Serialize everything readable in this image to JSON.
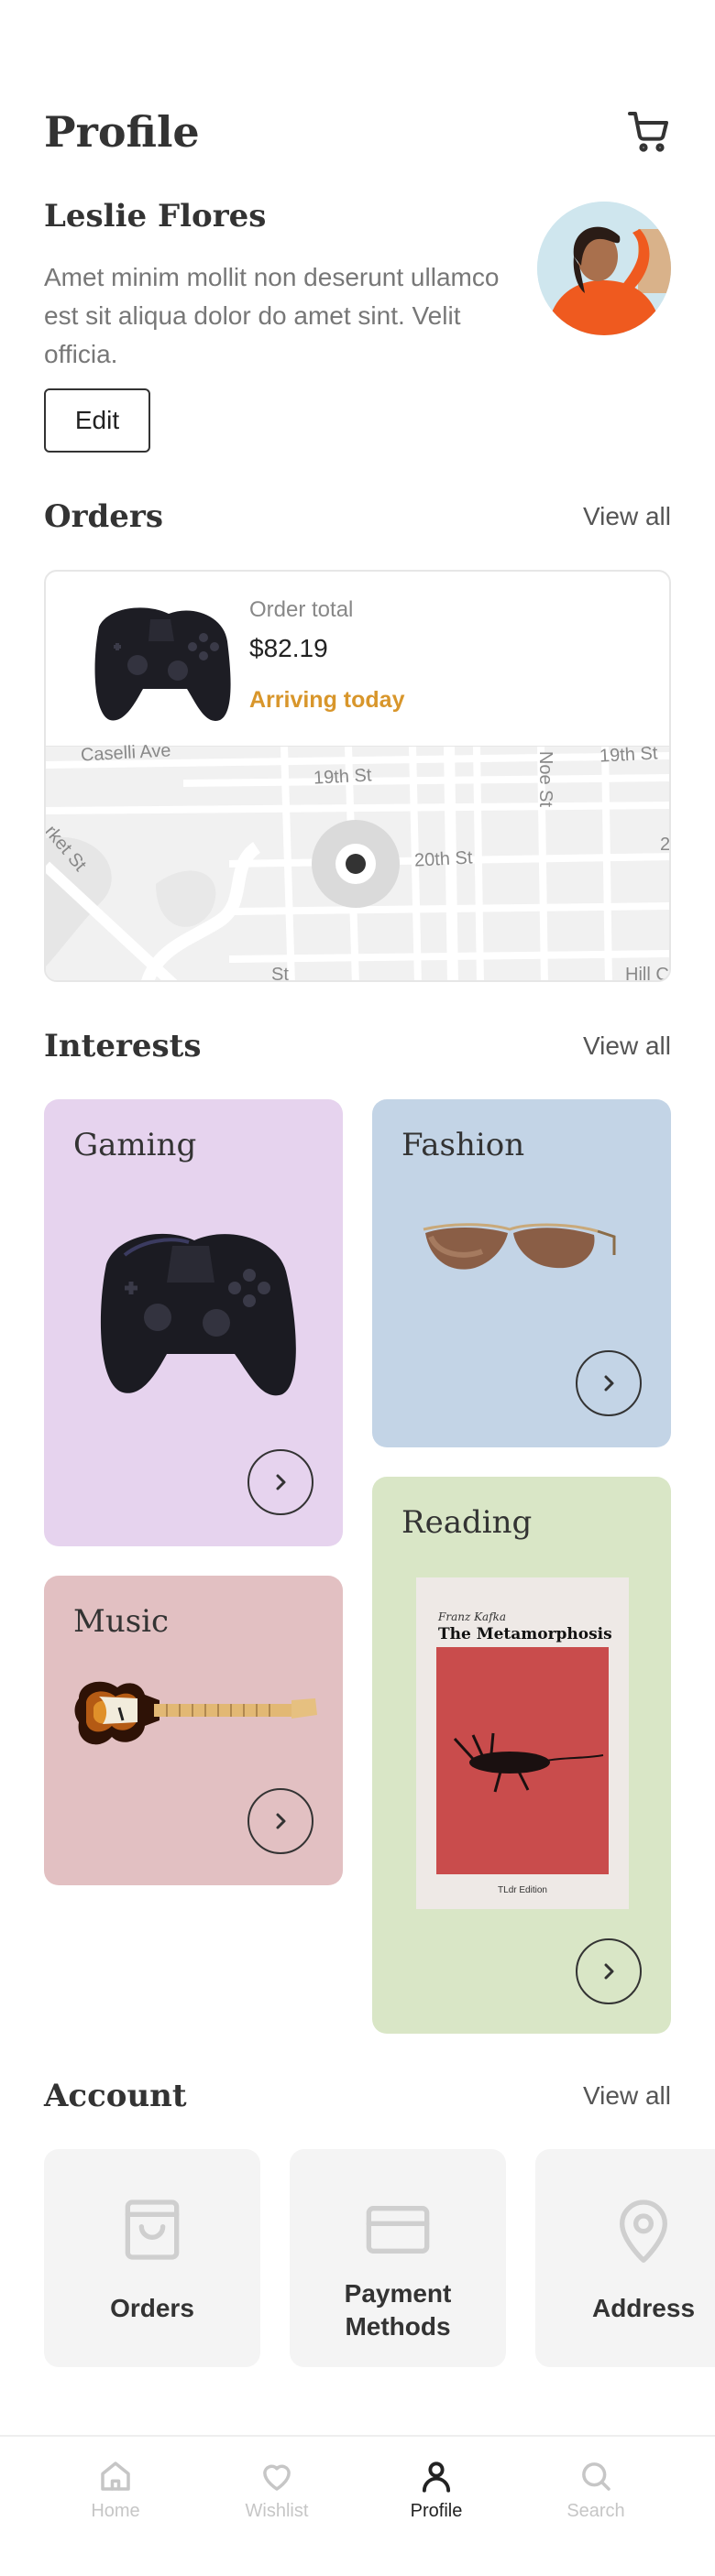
{
  "header": {
    "title": "Profile",
    "cart_icon": "cart-icon"
  },
  "user": {
    "name": "Leslie Flores",
    "bio": "Amet minim mollit non deserunt ullamco est sit aliqua dolor do amet sint. Velit officia.",
    "edit_label": "Edit"
  },
  "orders": {
    "title": "Orders",
    "view_all": "View all",
    "order": {
      "label": "Order total",
      "total": "$82.19",
      "status": "Arriving today",
      "status_color": "#d8962b"
    },
    "map": {
      "streets": [
        "Caselli Ave",
        "19th St",
        "Noe St",
        "19th St",
        "rket St",
        "20th St",
        "2",
        "St",
        "Hill C"
      ]
    }
  },
  "interests": {
    "title": "Interests",
    "view_all": "View all",
    "items": [
      {
        "label": "Gaming",
        "color": "#e6d3ee"
      },
      {
        "label": "Fashion",
        "color": "#c3d4e6"
      },
      {
        "label": "Music",
        "color": "#e2c0c2"
      },
      {
        "label": "Reading",
        "color": "#d9e6c6"
      }
    ],
    "book": {
      "author": "Franz Kafka",
      "title": "The Metamorphosis",
      "edition": "TLdr Edition"
    }
  },
  "account": {
    "title": "Account",
    "view_all": "View all",
    "items": [
      {
        "label": "Orders",
        "icon": "bag-icon"
      },
      {
        "label": "Payment Methods",
        "icon": "credit-card-icon"
      },
      {
        "label": "Address",
        "icon": "map-pin-icon"
      }
    ]
  },
  "tabbar": {
    "items": [
      {
        "label": "Home",
        "icon": "home-icon"
      },
      {
        "label": "Wishlist",
        "icon": "heart-icon"
      },
      {
        "label": "Profile",
        "icon": "user-icon"
      },
      {
        "label": "Search",
        "icon": "search-icon"
      }
    ],
    "active": "Profile"
  }
}
